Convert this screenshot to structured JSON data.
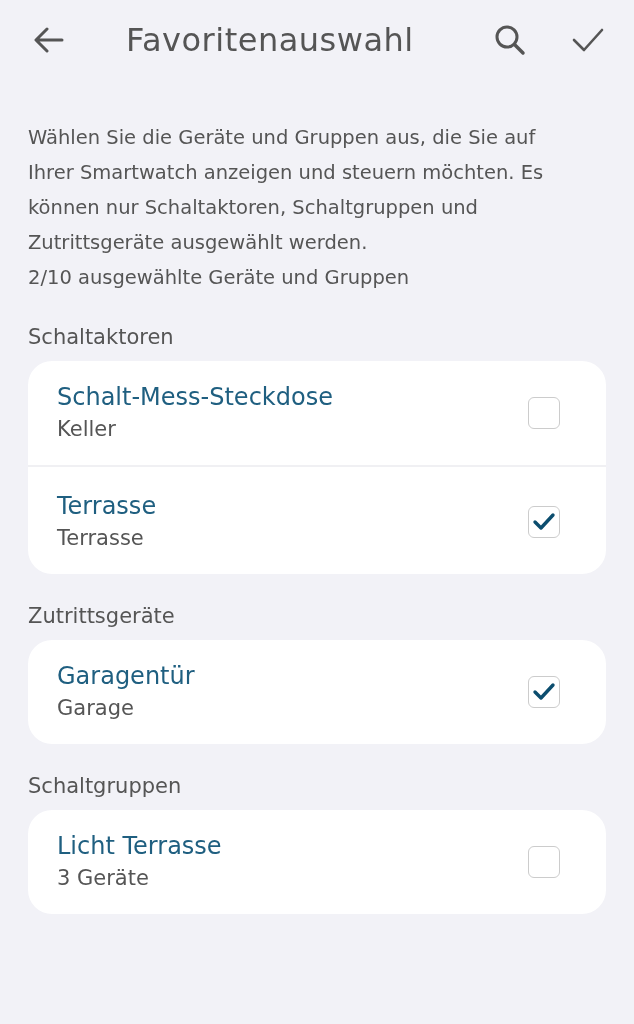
{
  "header": {
    "title": "Favoritenauswahl"
  },
  "intro": {
    "description": "Wählen Sie die Geräte und Gruppen aus, die Sie auf Ihrer Smartwatch anzeigen und steuern möchten. Es können nur Schaltaktoren, Schaltgruppen und Zutrittsgeräte ausgewählt werden.",
    "count": "2/10 ausgewählte Geräte und Gruppen"
  },
  "sections": [
    {
      "title": "Schaltaktoren",
      "items": [
        {
          "name": "Schalt-Mess-Steckdose",
          "location": "Keller",
          "checked": false
        },
        {
          "name": "Terrasse",
          "location": "Terrasse",
          "checked": true
        }
      ]
    },
    {
      "title": "Zutrittsgeräte",
      "items": [
        {
          "name": "Garagentür",
          "location": "Garage",
          "checked": true
        }
      ]
    },
    {
      "title": "Schaltgruppen",
      "items": [
        {
          "name": "Licht Terrasse",
          "location": "3 Geräte",
          "checked": false
        }
      ]
    }
  ]
}
